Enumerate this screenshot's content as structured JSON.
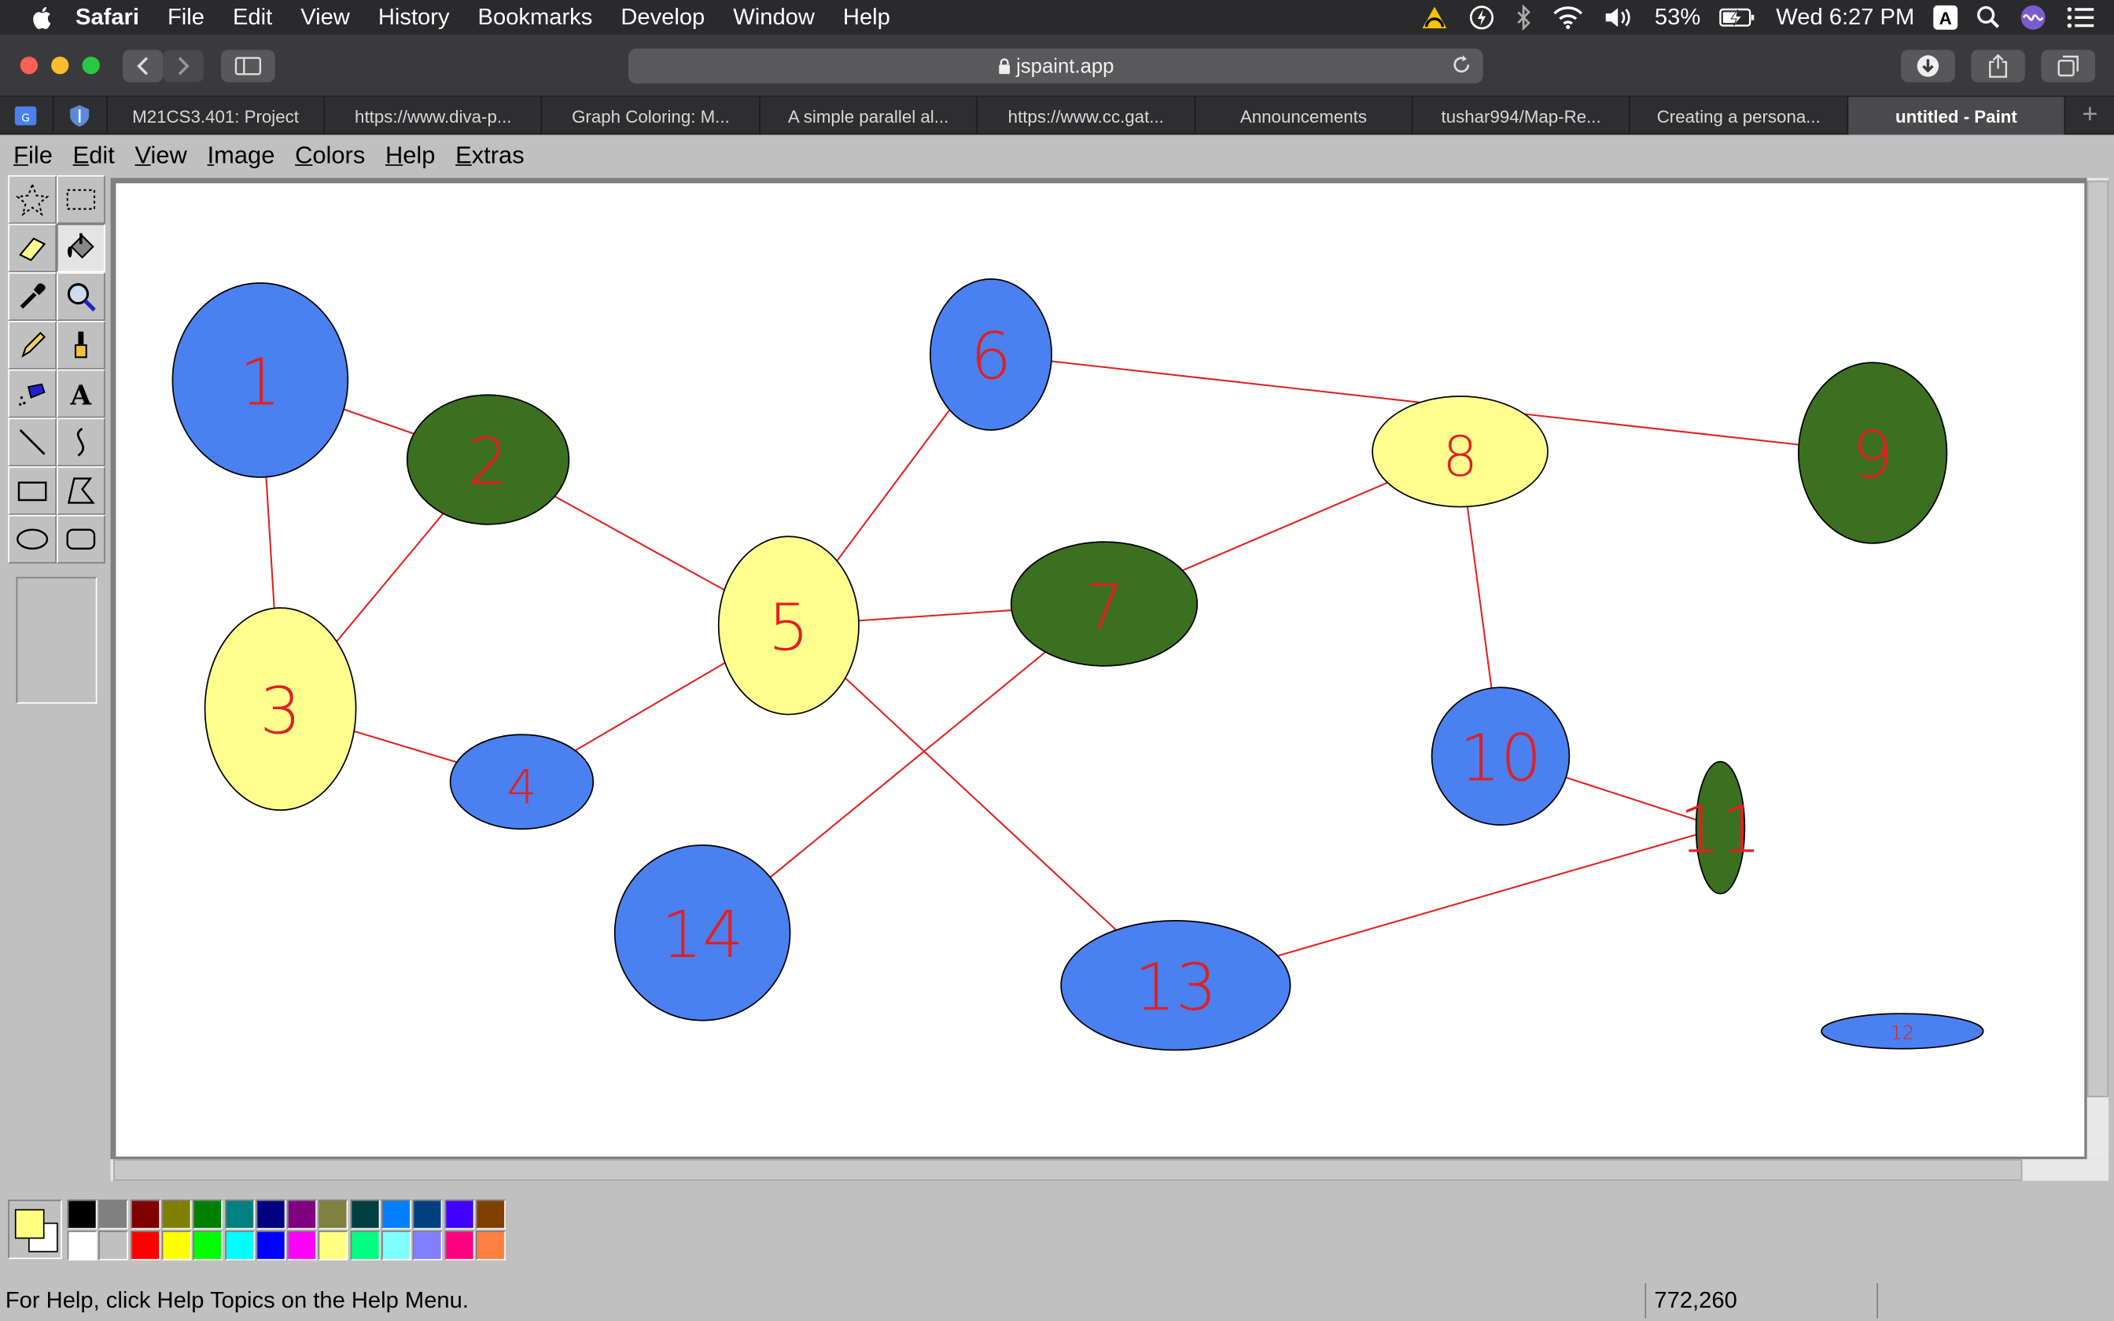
{
  "menubar": {
    "app": "Safari",
    "items": [
      "File",
      "Edit",
      "View",
      "History",
      "Bookmarks",
      "Develop",
      "Window",
      "Help"
    ],
    "battery": "53%",
    "clock": "Wed 6:27 PM",
    "input_source": "A"
  },
  "browser": {
    "url": "jspaint.app",
    "tabs": [
      {
        "label": "M21CS3.401: Project",
        "active": false
      },
      {
        "label": "https://www.diva-p...",
        "active": false
      },
      {
        "label": "Graph Coloring: M...",
        "active": false
      },
      {
        "label": "A simple parallel al...",
        "active": false
      },
      {
        "label": "https://www.cc.gat...",
        "active": false
      },
      {
        "label": "Announcements",
        "active": false
      },
      {
        "label": "tushar994/Map-Re...",
        "active": false
      },
      {
        "label": "Creating a persona...",
        "active": false
      },
      {
        "label": "untitled - Paint",
        "active": true
      }
    ],
    "new_tab": "+"
  },
  "paint": {
    "menus": [
      "File",
      "Edit",
      "View",
      "Image",
      "Colors",
      "Help",
      "Extras"
    ],
    "tools": [
      {
        "name": "free-form-select-tool",
        "selected": false
      },
      {
        "name": "rectangle-select-tool",
        "selected": false
      },
      {
        "name": "eraser-tool",
        "selected": false
      },
      {
        "name": "fill-bucket-tool",
        "selected": true
      },
      {
        "name": "pick-color-tool",
        "selected": false
      },
      {
        "name": "magnifier-tool",
        "selected": false
      },
      {
        "name": "pencil-tool",
        "selected": false
      },
      {
        "name": "brush-tool",
        "selected": false
      },
      {
        "name": "airbrush-tool",
        "selected": false
      },
      {
        "name": "text-tool",
        "selected": false
      },
      {
        "name": "line-tool",
        "selected": false
      },
      {
        "name": "curve-tool",
        "selected": false
      },
      {
        "name": "rectangle-tool",
        "selected": false
      },
      {
        "name": "polygon-tool",
        "selected": false
      },
      {
        "name": "ellipse-tool",
        "selected": false
      },
      {
        "name": "rounded-rectangle-tool",
        "selected": false
      }
    ],
    "foreground_color": "#ffff80",
    "background_color": "#ffffff",
    "palette_top": [
      "#000000",
      "#808080",
      "#800000",
      "#808000",
      "#008000",
      "#008080",
      "#000080",
      "#800080",
      "#808040",
      "#004040",
      "#0080ff",
      "#004080",
      "#4000ff",
      "#804000"
    ],
    "palette_bottom": [
      "#ffffff",
      "#c0c0c0",
      "#ff0000",
      "#ffff00",
      "#00ff00",
      "#00ffff",
      "#0000ff",
      "#ff00ff",
      "#ffff80",
      "#00ff80",
      "#80ffff",
      "#8080ff",
      "#ff0080",
      "#ff8040"
    ],
    "status_text": "For Help, click Help Topics on the Help Menu.",
    "cursor_position": "772,260",
    "graph": {
      "node_colors": {
        "blue": "#4a80f0",
        "green": "#3a7020",
        "yellow": "#ffff90"
      },
      "nodes": [
        {
          "label": "1",
          "color": "blue"
        },
        {
          "label": "2",
          "color": "green"
        },
        {
          "label": "3",
          "color": "yellow"
        },
        {
          "label": "4",
          "color": "blue"
        },
        {
          "label": "5",
          "color": "yellow"
        },
        {
          "label": "6",
          "color": "blue"
        },
        {
          "label": "7",
          "color": "green"
        },
        {
          "label": "8",
          "color": "yellow"
        },
        {
          "label": "9",
          "color": "green"
        },
        {
          "label": "10",
          "color": "blue"
        },
        {
          "label": "11",
          "color": "green"
        },
        {
          "label": "12",
          "color": "blue"
        },
        {
          "label": "13",
          "color": "blue"
        },
        {
          "label": "14",
          "color": "blue"
        }
      ],
      "edges": [
        [
          "1",
          "2"
        ],
        [
          "1",
          "3"
        ],
        [
          "2",
          "3"
        ],
        [
          "2",
          "5"
        ],
        [
          "3",
          "4"
        ],
        [
          "4",
          "5"
        ],
        [
          "5",
          "6"
        ],
        [
          "5",
          "7"
        ],
        [
          "5",
          "13"
        ],
        [
          "6",
          "9"
        ],
        [
          "7",
          "8"
        ],
        [
          "7",
          "14"
        ],
        [
          "8",
          "10"
        ],
        [
          "10",
          "11"
        ],
        [
          "11",
          "13"
        ]
      ]
    }
  }
}
